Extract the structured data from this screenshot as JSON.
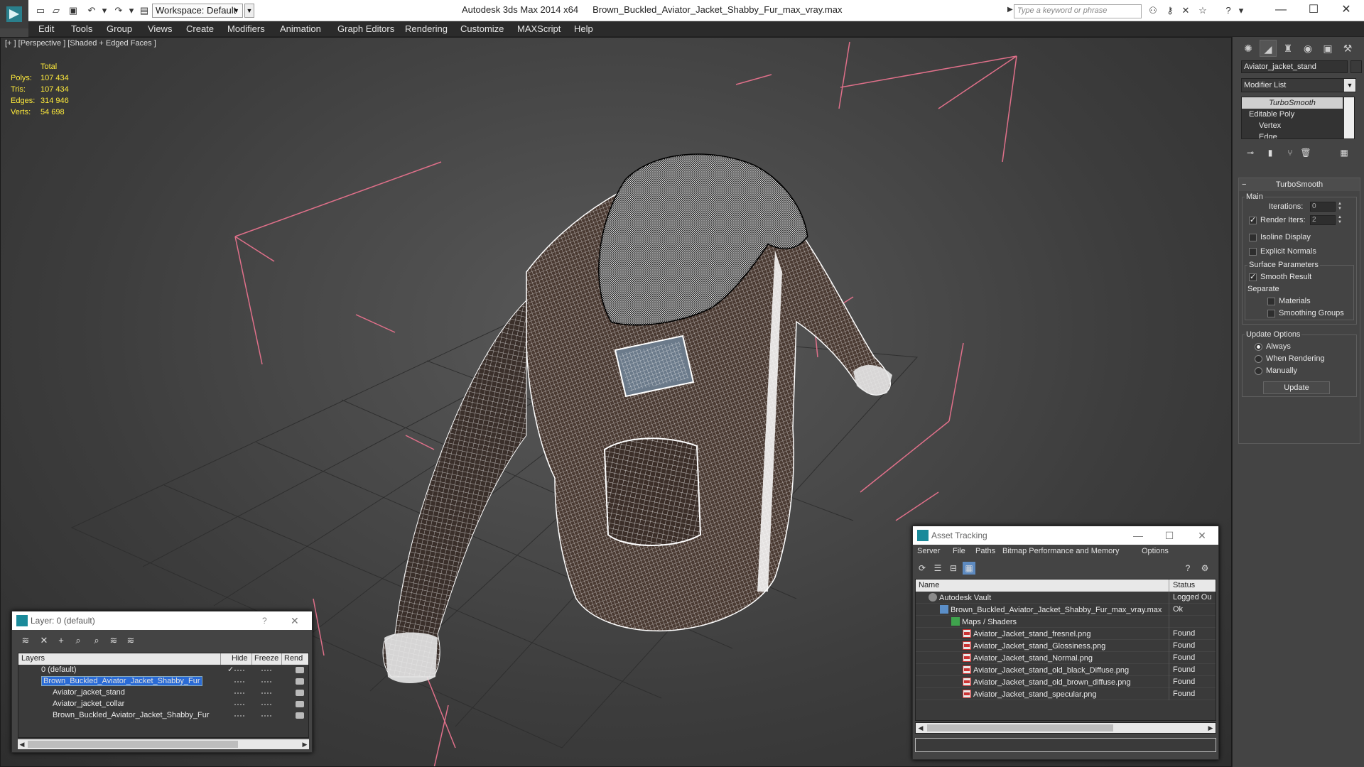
{
  "titlebar": {
    "workspace_label": "Workspace: Default",
    "app_name": "Autodesk 3ds Max  2014 x64",
    "file_name": "Brown_Buckled_Aviator_Jacket_Shabby_Fur_max_vray.max",
    "search_placeholder": "Type a keyword or phrase"
  },
  "menu": [
    "Edit",
    "Tools",
    "Group",
    "Views",
    "Create",
    "Modifiers",
    "Animation",
    "Graph Editors",
    "Rendering",
    "Customize",
    "MAXScript",
    "Help"
  ],
  "viewport": {
    "label": "[+ ] [Perspective ] [Shaded + Edged Faces ]",
    "stats_header": "Total",
    "stats": [
      {
        "key": "Polys:",
        "value": "107 434"
      },
      {
        "key": "Tris:",
        "value": "107 434"
      },
      {
        "key": "Edges:",
        "value": "314 946"
      },
      {
        "key": "Verts:",
        "value": "54 698"
      }
    ],
    "colors": {
      "grid": "#2f2f2f",
      "gizmo": "#e0708a",
      "wire": "#ffffff"
    }
  },
  "command_panel": {
    "object_name": "Aviator_jacket_stand",
    "modifier_list": "Modifier List",
    "stack": [
      "TurboSmooth",
      "Editable Poly",
      "Vertex",
      "Edge"
    ],
    "rollout_title": "TurboSmooth",
    "main_label": "Main",
    "iterations_label": "Iterations:",
    "iterations_value": "0",
    "render_iters_label": "Render Iters:",
    "render_iters_value": "2",
    "isoline_label": "Isoline Display",
    "explicit_normals_label": "Explicit Normals",
    "surface_params_label": "Surface Parameters",
    "smooth_result_label": "Smooth Result",
    "separate_label": "Separate",
    "materials_label": "Materials",
    "smoothing_groups_label": "Smoothing Groups",
    "update_options_label": "Update Options",
    "always_label": "Always",
    "when_rendering_label": "When Rendering",
    "manually_label": "Manually",
    "update_button": "Update"
  },
  "asset_tracking": {
    "title": "Asset Tracking",
    "menu": [
      "Server",
      "File",
      "Paths",
      "Bitmap Performance and Memory",
      "Options"
    ],
    "col_name": "Name",
    "col_status": "Status",
    "rows": [
      {
        "name": "Autodesk Vault",
        "status": "Logged Ou"
      },
      {
        "name": "Brown_Buckled_Aviator_Jacket_Shabby_Fur_max_vray.max",
        "status": "Ok"
      },
      {
        "name": "Maps / Shaders",
        "status": ""
      },
      {
        "name": "Aviator_Jacket_stand_fresnel.png",
        "status": "Found"
      },
      {
        "name": "Aviator_Jacket_stand_Glossiness.png",
        "status": "Found"
      },
      {
        "name": "Aviator_Jacket_stand_Normal.png",
        "status": "Found"
      },
      {
        "name": "Aviator_Jacket_stand_old_black_Diffuse.png",
        "status": "Found"
      },
      {
        "name": "Aviator_Jacket_stand_old_brown_diffuse.png",
        "status": "Found"
      },
      {
        "name": "Aviator_Jacket_stand_specular.png",
        "status": "Found"
      }
    ]
  },
  "layers": {
    "title": "Layer: 0 (default)",
    "help": "?",
    "col_layers": "Layers",
    "col_hide": "Hide",
    "col_freeze": "Freeze",
    "col_render": "Rend",
    "rows": [
      {
        "name": "0 (default)"
      },
      {
        "name": "Brown_Buckled_Aviator_Jacket_Shabby_Fur"
      },
      {
        "name": "Aviator_jacket_stand"
      },
      {
        "name": "Aviator_jacket_collar"
      },
      {
        "name": "Brown_Buckled_Aviator_Jacket_Shabby_Fur"
      }
    ]
  }
}
